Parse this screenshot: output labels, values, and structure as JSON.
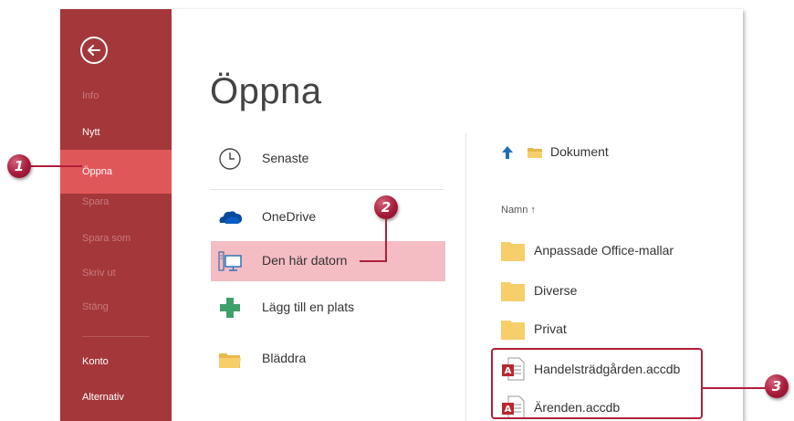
{
  "sidebar": {
    "back_icon": "back-arrow-circle-icon",
    "items": [
      {
        "label": "Info"
      },
      {
        "label": "Nytt"
      },
      {
        "label": "Öppna"
      },
      {
        "label": "Spara"
      },
      {
        "label": "Spara som"
      },
      {
        "label": "Skriv ut"
      },
      {
        "label": "Stäng"
      },
      {
        "label": "Konto"
      },
      {
        "label": "Alternativ"
      }
    ],
    "background_color": "#a4373a",
    "active_color": "#e0575a"
  },
  "main": {
    "title": "Öppna",
    "locations": [
      {
        "label": "Senaste",
        "icon": "clock-icon"
      },
      {
        "label": "OneDrive",
        "icon": "onedrive-cloud-icon"
      },
      {
        "label": "Den här datorn",
        "icon": "computer-icon"
      },
      {
        "label": "Lägg till en plats",
        "icon": "plus-icon"
      },
      {
        "label": "Bläddra",
        "icon": "folder-icon"
      }
    ],
    "selected_location_color": "#f4bcc3"
  },
  "pane": {
    "folder": "Dokument",
    "column_header": "Namn ↑",
    "items": [
      {
        "label": "Anpassade Office-mallar",
        "type": "folder"
      },
      {
        "label": "Diverse",
        "type": "folder"
      },
      {
        "label": "Privat",
        "type": "folder"
      },
      {
        "label": "Handelsträdgården.accdb",
        "type": "access-database"
      },
      {
        "label": "Ärenden.accdb",
        "type": "access-database"
      }
    ]
  },
  "callouts": [
    "1",
    "2",
    "3"
  ],
  "callout_color": "#b01f3a"
}
